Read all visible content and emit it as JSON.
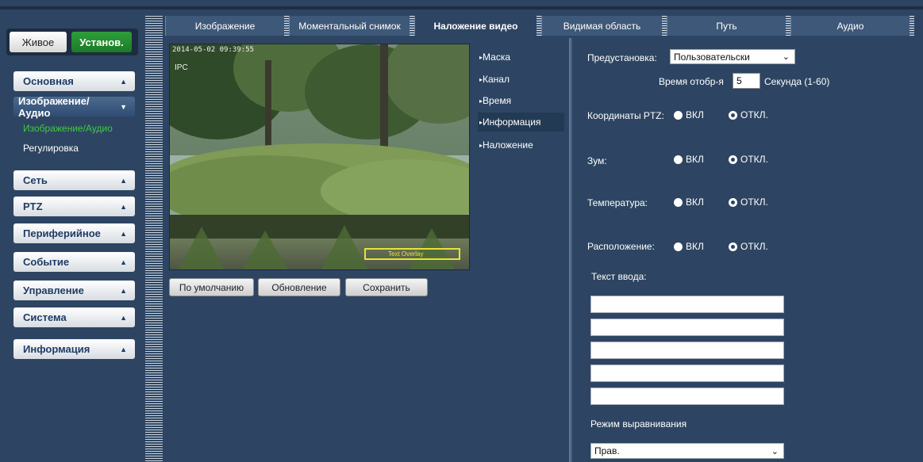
{
  "mode": {
    "live_label": "Живое",
    "setup_label": "Установ."
  },
  "menu": {
    "basic": "Основная",
    "image_audio": "Изображение/Аудио",
    "image_audio_sub": "Изображение/Аудио",
    "adjust_sub": "Регулировка",
    "network": "Сеть",
    "ptz": "PTZ",
    "peripheral": "Периферийное",
    "event": "Событие",
    "management": "Управление",
    "system": "Система",
    "info": "Информация"
  },
  "tabs": [
    "Изображение",
    "Моментальный снимок",
    "Наложение видео",
    "Видимая область",
    "Путь",
    "Аудио"
  ],
  "video": {
    "osd_time": "2014-05-02 09:39:55",
    "osd_channel": "IPC",
    "osd_text": "Text Overlay"
  },
  "buttons": {
    "default": "По умолчанию",
    "refresh": "Обновление",
    "save": "Сохранить"
  },
  "overlay_menu": [
    "Маска",
    "Канал",
    "Время",
    "Информация",
    "Наложение"
  ],
  "form": {
    "preset_label": "Предустановка:",
    "preset_value": "Пользовательски",
    "display_time_label": "Время отобр-я",
    "display_time_value": "5",
    "display_time_unit": "Секунда (1-60)",
    "ptz_coords_label": "Координаты PTZ:",
    "zoom_label": "Зум:",
    "temperature_label": "Температура:",
    "location_label": "Расположение:",
    "on_label": "ВКЛ",
    "off_label": "ОТКЛ.",
    "text_input_label": "Текст ввода:",
    "align_label": "Режим выравнивания",
    "align_value": "Прав."
  },
  "colors": {
    "background": "#2d4562",
    "accent_green": "#3ecc3e",
    "osd_yellow": "#e6e23a"
  }
}
